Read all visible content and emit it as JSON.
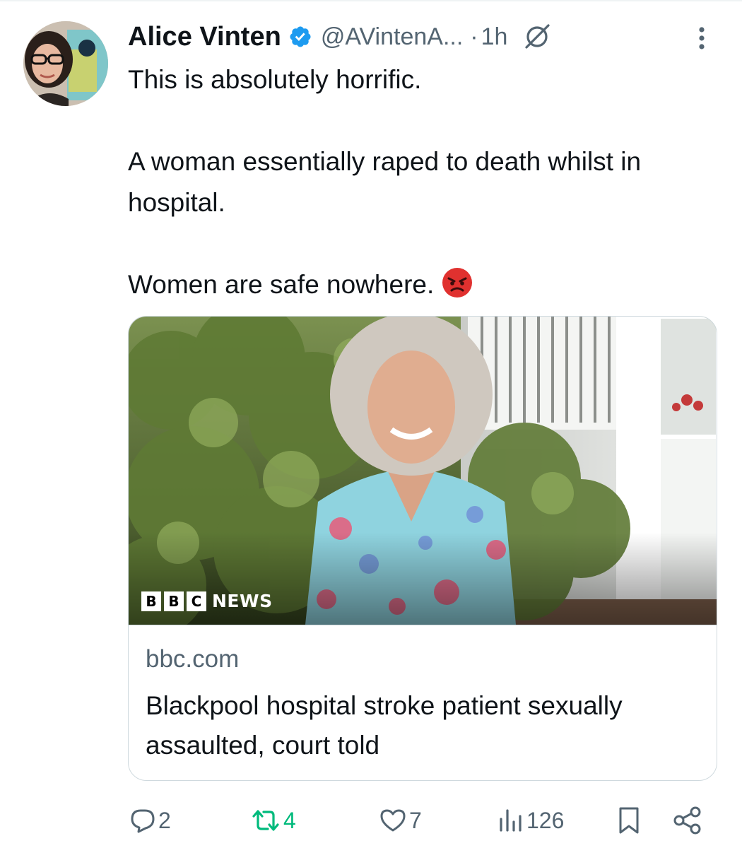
{
  "tweet": {
    "author": {
      "display_name": "Alice Vinten",
      "handle": "@AVintenA...",
      "separator": "·",
      "time": "1h"
    },
    "text": {
      "line1": "This is absolutely horrific.",
      "line2": "A woman essentially raped to death whilst in hospital.",
      "line3": "Women are safe nowhere."
    },
    "emoji": "angry-face-emoji",
    "card": {
      "image_logo": {
        "blocks": [
          "B",
          "B",
          "C"
        ],
        "word": "NEWS"
      },
      "domain": "bbc.com",
      "title": "Blackpool hospital stroke patient sexually assaulted, court told"
    },
    "actions": {
      "replies": "2",
      "reposts": "4",
      "likes": "7",
      "views": "126"
    }
  },
  "colors": {
    "text": "#0f1419",
    "secondary": "#536471",
    "verified": "#1d9bf0",
    "repost": "#00ba7c",
    "border": "#cfd9de"
  },
  "icons": [
    "verified-badge-icon",
    "grok-icon",
    "more-icon",
    "reply-icon",
    "repost-icon",
    "like-icon",
    "views-icon",
    "bookmark-icon",
    "share-icon"
  ]
}
